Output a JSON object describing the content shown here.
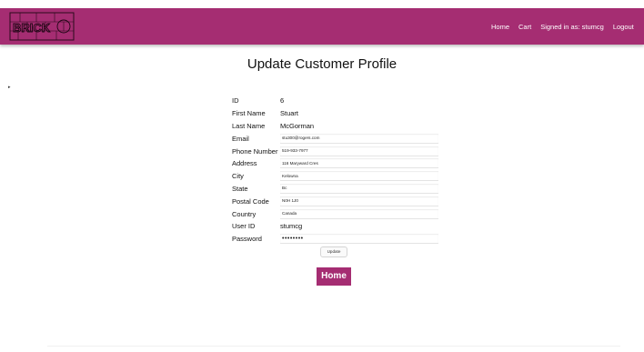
{
  "header": {
    "brand_text": "BRICK",
    "nav_home": "Home",
    "nav_cart": "Cart",
    "signed_in": "Signed in as: stumcg",
    "nav_logout": "Logout",
    "brand_color": "#a52d72"
  },
  "page_title": "Update Customer Profile",
  "stray_mark": "▸",
  "form": {
    "id_label": "ID",
    "id_value": "6",
    "first_name_label": "First Name",
    "first_name_value": "Stuart",
    "last_name_label": "Last Name",
    "last_name_value": "McGorman",
    "email_label": "Email",
    "email_value": "stu300@rogers.com",
    "phone_label": "Phone Number",
    "phone_value": "519-933-7977",
    "address_label": "Address",
    "address_value": "116 Maryward Cres",
    "city_label": "City",
    "city_value": "Kelowna",
    "state_label": "State",
    "state_value": "Bc",
    "postal_label": "Postal Code",
    "postal_value": "N0H 1J0",
    "country_label": "Country",
    "country_value": "Canada",
    "userid_label": "User ID",
    "userid_value": "stumcg",
    "password_label": "Password",
    "password_value": "stumcg12",
    "update_label": "Update"
  },
  "home_button": "Home"
}
